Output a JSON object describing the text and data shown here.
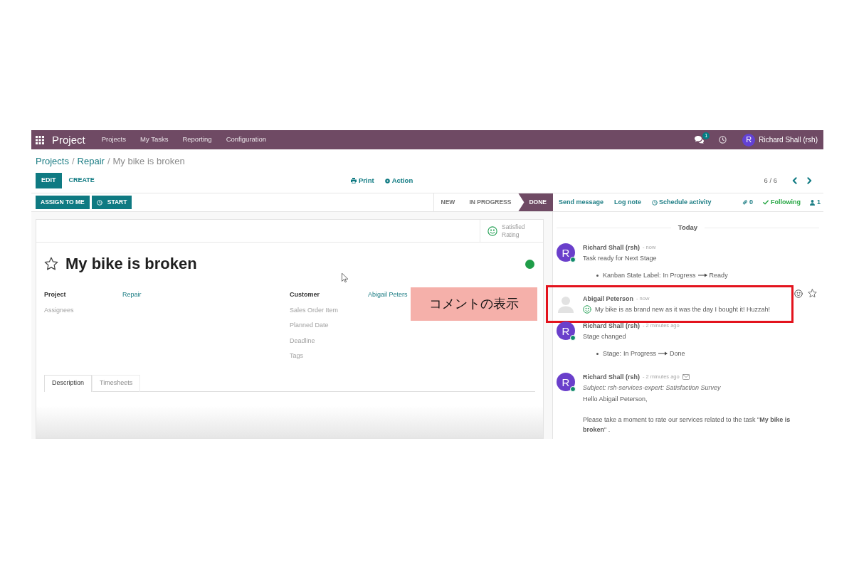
{
  "navbar": {
    "app_name": "Project",
    "menu": [
      {
        "label": "Projects"
      },
      {
        "label": "My Tasks"
      },
      {
        "label": "Reporting"
      },
      {
        "label": "Configuration"
      }
    ],
    "message_count": "1",
    "user": {
      "initial": "R",
      "name": "Richard Shall (rsh)"
    }
  },
  "breadcrumb": {
    "items": [
      {
        "label": "Projects",
        "current": false
      },
      {
        "separator": "/",
        "label": "Repair",
        "current": false
      },
      {
        "separator": "/",
        "label": "My bike is broken",
        "current": true
      }
    ]
  },
  "control_panel": {
    "buttons": [
      {
        "label": "EDIT",
        "kind": "primary"
      },
      {
        "label": "CREATE",
        "kind": "link"
      }
    ],
    "actions": [
      {
        "label": "Print"
      },
      {
        "label": "Action"
      }
    ],
    "pager": "6 / 6"
  },
  "statusbar": {
    "buttons": [
      {
        "label": "ASSIGN TO ME"
      },
      {
        "label": "START"
      }
    ],
    "stages": [
      {
        "label": "NEW",
        "selected": false
      },
      {
        "label": "IN PROGRESS",
        "selected": false
      },
      {
        "label": "DONE",
        "selected": true
      }
    ]
  },
  "form": {
    "rating": {
      "label": "Satisfied",
      "caption": "Rating"
    },
    "starred": false,
    "title": "My bike is broken",
    "kanban_ready": true,
    "fields_left": [
      {
        "label": "Project",
        "value": "Repair",
        "emphasized": true
      },
      {
        "label": "Assignees",
        "emphasized": false
      }
    ],
    "fields_right": [
      {
        "label": "Customer",
        "value": "Abigail Peters",
        "emphasized": true
      },
      {
        "label": "Sales Order Item",
        "emphasized": false
      },
      {
        "label": "Planned Date",
        "emphasized": false
      },
      {
        "label": "Deadline",
        "emphasized": false
      },
      {
        "label": "Tags",
        "emphasized": false
      }
    ],
    "tabs": [
      {
        "label": "Description",
        "selected": true
      },
      {
        "label": "Timesheets",
        "selected": false
      }
    ]
  },
  "chatter": {
    "actions": [
      {
        "label": "Send message"
      },
      {
        "label": "Log note"
      },
      {
        "label": "Schedule activity"
      }
    ],
    "attachment_count": "0",
    "follow": {
      "label": "Following",
      "following": true
    },
    "follower_count": "1",
    "date_separator": "Today",
    "messages": [
      {
        "author": "Richard Shall (rsh)",
        "time": "- now",
        "avatar": {
          "kind": "initial",
          "letter": "R",
          "online": true
        },
        "email": false,
        "rated": false,
        "hovered": false,
        "highlighted": false,
        "body": "Task ready for Next Stage",
        "changes": [
          {
            "field": "Kanban State Label:",
            "old": "In Progress",
            "new": "Ready"
          }
        ]
      },
      {
        "author": "Abigail Peterson",
        "time": "- now",
        "avatar": {
          "kind": "placeholder",
          "online": false
        },
        "email": false,
        "rated": true,
        "hovered": true,
        "highlighted": true,
        "body": "My bike is as brand new as it was the day I bought it! Huzzah!"
      },
      {
        "author": "Richard Shall (rsh)",
        "time": "- 2 minutes ago",
        "avatar": {
          "kind": "initial",
          "letter": "R",
          "online": true
        },
        "email": false,
        "rated": false,
        "hovered": false,
        "highlighted": false,
        "body": "Stage changed",
        "changes": [
          {
            "field": "Stage:",
            "old": "In Progress",
            "new": "Done"
          }
        ]
      },
      {
        "author": "Richard Shall (rsh)",
        "time": "- 2 minutes ago",
        "avatar": {
          "kind": "initial",
          "letter": "R",
          "online": true
        },
        "email": true,
        "rated": false,
        "hovered": false,
        "highlighted": false,
        "subject": "Subject: rsh-services-expert: Satisfaction Survey",
        "paragraphs": [
          "Hello Abigail Peterson,",
          "Please take a moment to rate our services related to the task \"**My bike is broken**\" ."
        ]
      }
    ]
  },
  "annotation": {
    "label": "コメントの表示"
  }
}
